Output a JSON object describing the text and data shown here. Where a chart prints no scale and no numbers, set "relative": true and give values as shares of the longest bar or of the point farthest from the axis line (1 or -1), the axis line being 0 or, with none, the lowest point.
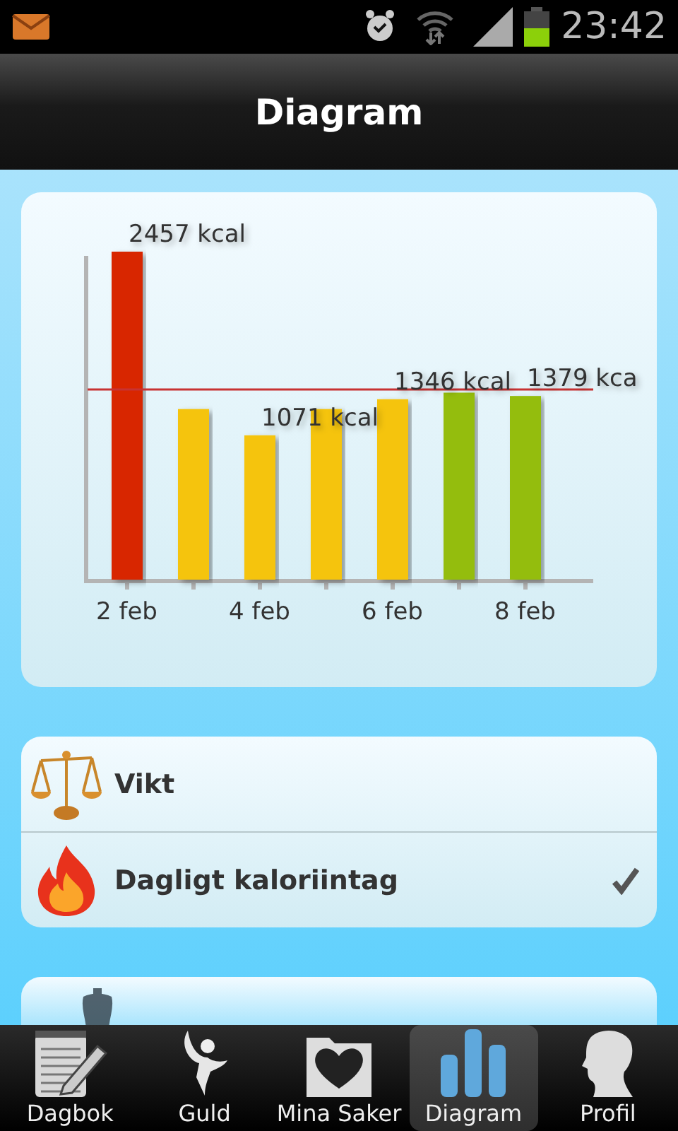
{
  "status_bar": {
    "time": "23:42"
  },
  "title": "Diagram",
  "chart": {
    "chart_data": {
      "type": "bar",
      "relative": true,
      "categories": [
        "2 feb",
        null,
        "4 feb",
        null,
        "6 feb",
        null,
        "8 feb"
      ],
      "stacked": true,
      "series": [
        {
          "color": "#d82800",
          "values": [
            1.0,
            null,
            null,
            null,
            null,
            null,
            null
          ]
        },
        {
          "color": "#f5c408",
          "values": [
            null,
            0.52,
            0.44,
            0.52,
            0.55,
            null,
            null
          ]
        },
        {
          "color": "#94bd0c",
          "values": [
            null,
            null,
            null,
            null,
            null,
            0.57,
            0.56
          ]
        }
      ],
      "value_labels": [
        "2457 kcal",
        null,
        "1071 kcal",
        null,
        "1346 kcal",
        null,
        "1379 kca"
      ],
      "ref_lines": [
        {
          "axis": "y",
          "value": 0.58,
          "color": "#c83232"
        }
      ]
    }
  },
  "list": [
    {
      "kind": "scale",
      "label": "Vikt",
      "selected": false
    },
    {
      "kind": "flame",
      "label": "Dagligt kaloriintag",
      "selected": true
    }
  ],
  "partial_card": {
    "kind": "mannequin"
  },
  "tabs": [
    {
      "kind": "notepad",
      "label": "Dagbok",
      "selected": false
    },
    {
      "kind": "figure",
      "label": "Guld",
      "selected": false
    },
    {
      "kind": "heart-folder",
      "label": "Mina Saker",
      "selected": false
    },
    {
      "kind": "bars",
      "label": "Diagram",
      "selected": true
    },
    {
      "kind": "head",
      "label": "Profil",
      "selected": false
    }
  ]
}
